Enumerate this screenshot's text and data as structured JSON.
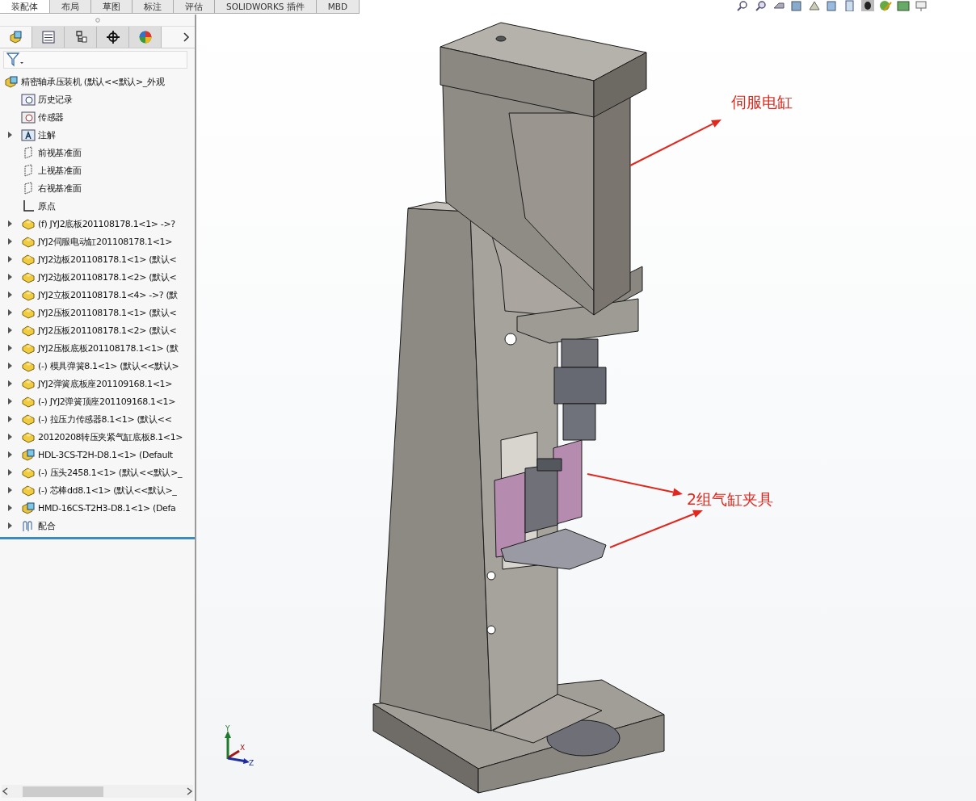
{
  "command_tabs": [
    {
      "label": "装配体",
      "selected": true
    },
    {
      "label": "布局",
      "selected": false
    },
    {
      "label": "草图",
      "selected": false
    },
    {
      "label": "标注",
      "selected": false
    },
    {
      "label": "评估",
      "selected": false
    },
    {
      "label": "SOLIDWORKS 插件",
      "selected": false
    },
    {
      "label": "MBD",
      "selected": false
    }
  ],
  "panel_tabs": [
    {
      "kind": "feature",
      "selected": true
    },
    {
      "kind": "property",
      "selected": false
    },
    {
      "kind": "config",
      "selected": false
    },
    {
      "kind": "dimxpert",
      "selected": false
    },
    {
      "kind": "display",
      "selected": false
    }
  ],
  "feature_tree": {
    "root": {
      "label": "精密轴承压装机 (默认<<默认>_外观",
      "kind": "assembly"
    },
    "items": [
      {
        "label": "历史记录",
        "kind": "history"
      },
      {
        "label": "传感器",
        "kind": "sensor"
      },
      {
        "label": "注解",
        "kind": "annotation",
        "expanded": false
      },
      {
        "label": "前视基准面",
        "kind": "plane"
      },
      {
        "label": "上视基准面",
        "kind": "plane"
      },
      {
        "label": "右视基准面",
        "kind": "plane"
      },
      {
        "label": "原点",
        "kind": "origin"
      },
      {
        "label": "(f) JYJ2底板201108178.1<1> ->?",
        "kind": "part",
        "expanded": false
      },
      {
        "label": "JYJ2伺服电动缸201108178.1<1>",
        "kind": "part",
        "expanded": false
      },
      {
        "label": "JYJ2边板201108178.1<1> (默认<",
        "kind": "part",
        "expanded": false
      },
      {
        "label": "JYJ2边板201108178.1<2> (默认<",
        "kind": "part",
        "expanded": false
      },
      {
        "label": "JYJ2立板201108178.1<4> ->? (默",
        "kind": "part",
        "expanded": false
      },
      {
        "label": "JYJ2压板201108178.1<1> (默认<",
        "kind": "part",
        "expanded": false
      },
      {
        "label": "JYJ2压板201108178.1<2> (默认<",
        "kind": "part",
        "expanded": false
      },
      {
        "label": "JYJ2压板底板201108178.1<1> (默",
        "kind": "part",
        "expanded": false
      },
      {
        "label": "(-) 模具弹簧8.1<1> (默认<<默认>",
        "kind": "part",
        "expanded": false
      },
      {
        "label": "JYJ2弹簧底板座201109168.1<1>",
        "kind": "part",
        "expanded": false
      },
      {
        "label": "(-) JYJ2弹簧顶座201109168.1<1>",
        "kind": "part",
        "expanded": false
      },
      {
        "label": "(-) 拉压力传感器8.1<1> (默认<<",
        "kind": "part",
        "expanded": false
      },
      {
        "label": "20120208转压夹紧气缸底板8.1<1>",
        "kind": "part",
        "expanded": false
      },
      {
        "label": "HDL-3CS-T2H-D8.1<1> (Default",
        "kind": "assembly",
        "expanded": false
      },
      {
        "label": "(-) 压头2458.1<1> (默认<<默认>_",
        "kind": "part",
        "expanded": false
      },
      {
        "label": "(-) 芯棒dd8.1<1> (默认<<默认>_",
        "kind": "part",
        "expanded": false
      },
      {
        "label": "HMD-16CS-T2H3-D8.1<1> (Defa",
        "kind": "assembly",
        "expanded": false
      },
      {
        "label": "配合",
        "kind": "mates",
        "expanded": false
      }
    ]
  },
  "callouts": [
    {
      "label": "伺服电缸"
    },
    {
      "label": "2组气缸夹具"
    }
  ],
  "triad": {
    "x": "X",
    "y": "Y",
    "z": "Z"
  }
}
